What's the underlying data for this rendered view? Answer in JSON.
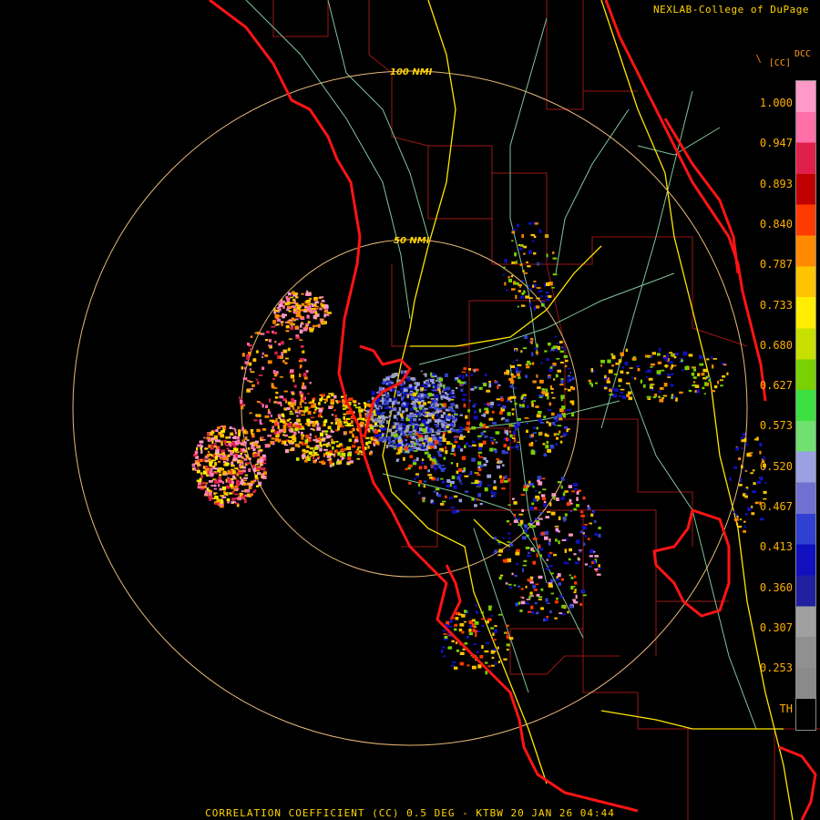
{
  "credit": "NEXLAB-College of DuPage",
  "product_code": "DCC",
  "units": "[CC]",
  "footer": "CORRELATION COEFFICIENT (CC) 0.5 DEG - KTBW 20 JAN 26 04:44",
  "range_rings": [
    {
      "label": "100 NMI"
    },
    {
      "label": "50 NMI"
    }
  ],
  "colorbar": {
    "ticks": [
      "1.000",
      "0.947",
      "0.893",
      "0.840",
      "0.787",
      "0.733",
      "0.680",
      "0.627",
      "0.573",
      "0.520",
      "0.467",
      "0.413",
      "0.360",
      "0.307",
      "0.253",
      "TH"
    ],
    "colors": [
      "#ff9ac8",
      "#ff6fa8",
      "#e0204a",
      "#c00000",
      "#ff3a00",
      "#ff8a00",
      "#ffc400",
      "#ffee00",
      "#c8e000",
      "#7ad000",
      "#3ce040",
      "#70e070",
      "#9aa0e0",
      "#7070d0",
      "#3040d0",
      "#1010c0",
      "#2020a0",
      "#a0a0a0",
      "#909090",
      "#8a8a8a",
      "#000000"
    ]
  },
  "colors": {
    "coast": "#ff1010",
    "counties": "#a01818",
    "roads": "#8ed0a0",
    "highways": "#ffee00",
    "rings": "#f0c080",
    "text": "#ffd400"
  }
}
